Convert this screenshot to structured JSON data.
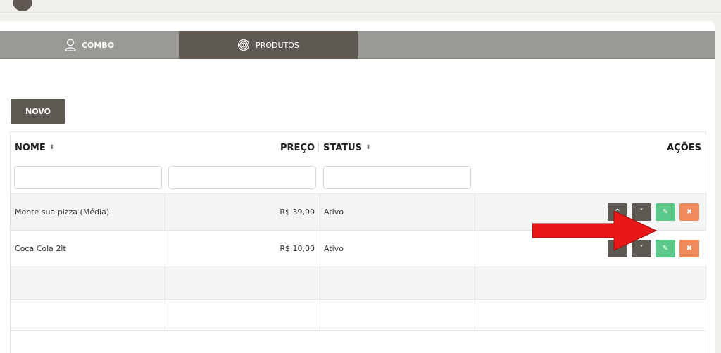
{
  "tabs": {
    "combo": "COMBO",
    "produtos": "PRODUTOS"
  },
  "buttons": {
    "novo": "NOVO"
  },
  "table": {
    "headers": {
      "nome": "NOME",
      "preco": "PREÇO",
      "status": "STATUS",
      "acoes": "AÇÕES"
    },
    "sort_glyph": "⬍",
    "rows": [
      {
        "nome": "Monte sua pizza (Média)",
        "preco": "R$ 39,90",
        "status": "Ativo"
      },
      {
        "nome": "Coca Cola 2lt",
        "preco": "R$ 10,00",
        "status": "Ativo"
      }
    ],
    "actions": {
      "up_glyph": "^",
      "down_glyph": "˅",
      "edit_glyph": "✎",
      "delete_glyph": "✖"
    }
  },
  "annotation": {
    "arrow_color": "#e81818"
  },
  "icons": [
    "user-icon",
    "fingerprint-icon",
    "sort-icon",
    "chevron-up-icon",
    "chevron-down-icon",
    "edit-icon",
    "delete-icon"
  ],
  "colors": {
    "dark_button": "#5f5954",
    "edit_button": "#5cc98a",
    "delete_button": "#ef8a5a",
    "tab_bar": "#9b9996"
  }
}
